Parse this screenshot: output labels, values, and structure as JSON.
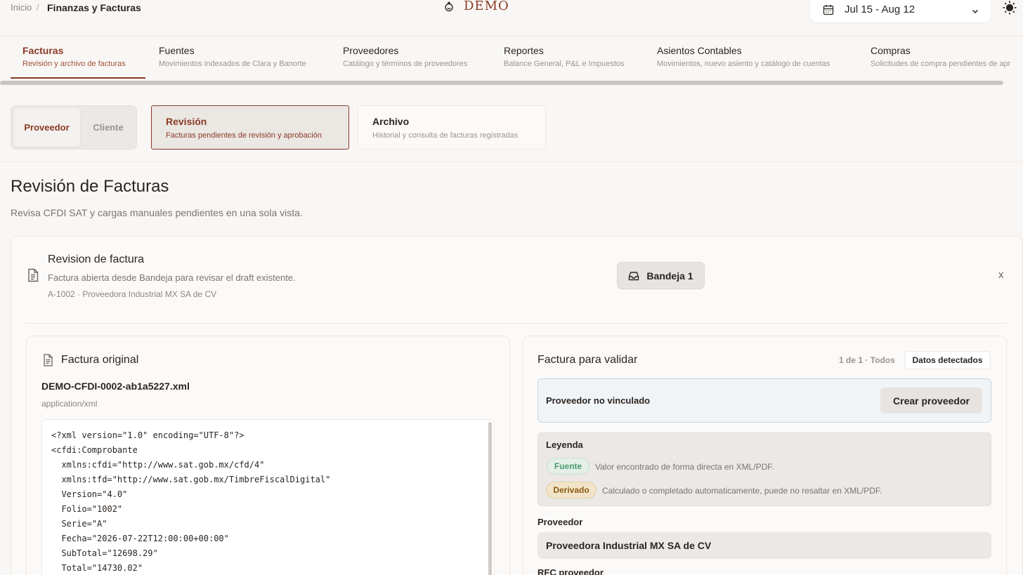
{
  "breadcrumb": {
    "home": "Inicio",
    "current": "Finanzas y Facturas"
  },
  "brand": {
    "name": "DEMO",
    "accent": "#8a3a25"
  },
  "date_range": {
    "label": "Jul 15 - Aug 12"
  },
  "nav_tabs": [
    {
      "title": "Facturas",
      "subtitle": "Revisión y archivo de facturas"
    },
    {
      "title": "Fuentes",
      "subtitle": "Movimientos indexados de Clara y Banorte"
    },
    {
      "title": "Proveedores",
      "subtitle": "Catálogo y términos de proveedores"
    },
    {
      "title": "Reportes",
      "subtitle": "Balance General, P&L e Impuestos"
    },
    {
      "title": "Asientos Contables",
      "subtitle": "Movimientos, nuevo asiento y catálogo de cuentas"
    },
    {
      "title": "Compras",
      "subtitle": "Solicitudes de compra pendientes de apr"
    }
  ],
  "segment": {
    "proveedor": "Proveedor",
    "cliente": "Cliente"
  },
  "modes": {
    "revision": {
      "title": "Revisión",
      "subtitle": "Facturas pendientes de revisión y aprobación"
    },
    "archivo": {
      "title": "Archivo",
      "subtitle": "Historial y consulta de facturas registradas"
    }
  },
  "page": {
    "title": "Revisión de Facturas",
    "subtitle": "Revisa CFDI SAT y cargas manuales pendientes en una sola vista."
  },
  "review": {
    "title": "Revision de factura",
    "subtitle": "Factura abierta desde Bandeja para revisar el draft existente.",
    "meta": "A-1002 · Proveedora Industrial MX SA de CV",
    "bandeja_label": "Bandeja 1",
    "close_label": "x"
  },
  "original": {
    "title": "Factura original",
    "file_name": "DEMO-CFDI-0002-ab1a5227.xml",
    "mime": "application/xml",
    "code": "<?xml version=\"1.0\" encoding=\"UTF-8\"?>\n<cfdi:Comprobante\n  xmlns:cfdi=\"http://www.sat.gob.mx/cfd/4\"\n  xmlns:tfd=\"http://www.sat.gob.mx/TimbreFiscalDigital\"\n  Version=\"4.0\"\n  Folio=\"1002\"\n  Serie=\"A\"\n  Fecha=\"2026-07-22T12:00:00+00:00\"\n  SubTotal=\"12698.29\"\n  Total=\"14730.02\""
  },
  "validate": {
    "title": "Factura para validar",
    "count": "1 de 1 · Todos",
    "chip": "Datos detectados",
    "provider_status": "Proveedor no vinculado",
    "create_provider": "Crear proveedor",
    "legend": {
      "title": "Leyenda",
      "fuente_badge": "Fuente",
      "fuente_desc": "Valor encontrado de forma directa en XML/PDF.",
      "derivado_badge": "Derivado",
      "derivado_desc": "Calculado o completado automaticamente, puede no resaltar en XML/PDF."
    },
    "proveedor_label": "Proveedor",
    "proveedor_value": "Proveedora Industrial MX SA de CV",
    "rfc_label": "RFC proveedor"
  }
}
